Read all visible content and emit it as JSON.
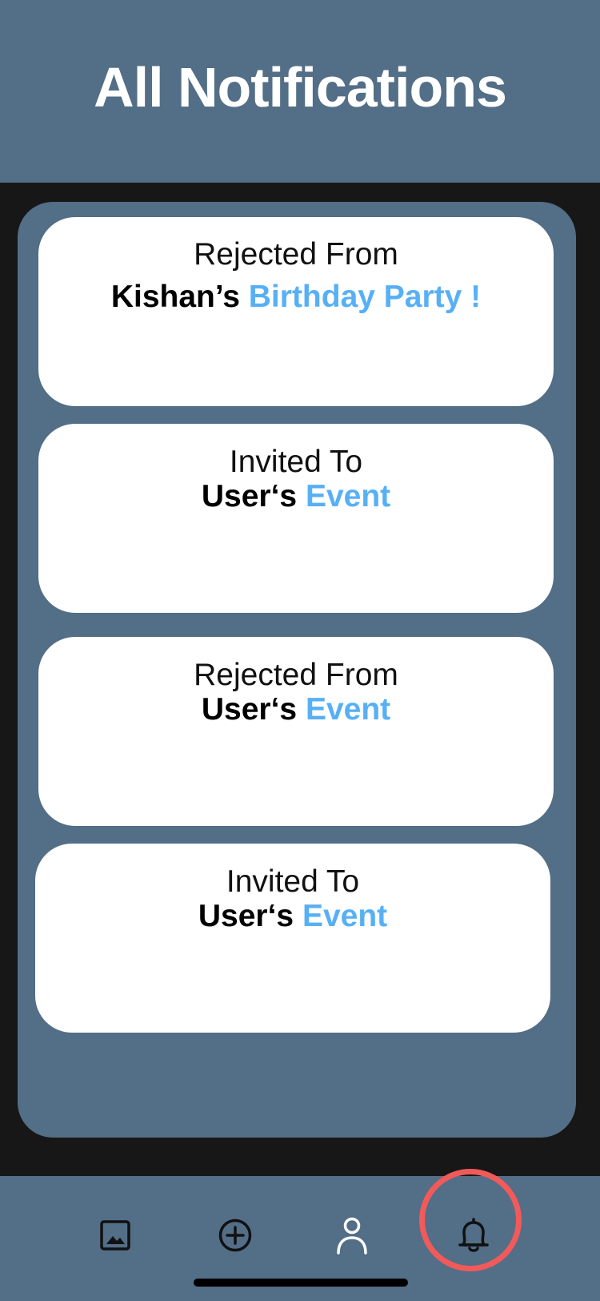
{
  "header": {
    "title": "All Notifications"
  },
  "notifications": [
    {
      "action": "Rejected From",
      "owner": "Kishan’s",
      "event": "Birthday Party !"
    },
    {
      "action": "Invited To",
      "owner": "User‘s",
      "event": "Event"
    },
    {
      "action": "Rejected From",
      "owner": "User‘s",
      "event": "Event"
    },
    {
      "action": "Invited To",
      "owner": "User‘s",
      "event": "Event"
    }
  ],
  "tabbar": {
    "tabs": [
      {
        "icon": "image-icon"
      },
      {
        "icon": "plus-circle-icon"
      },
      {
        "icon": "user-icon"
      },
      {
        "icon": "bell-icon",
        "active": true
      }
    ],
    "highlight_color": "#f25a5a"
  },
  "colors": {
    "header_bg": "#536e87",
    "page_bg": "#171717",
    "accent": "#57b0f5"
  }
}
